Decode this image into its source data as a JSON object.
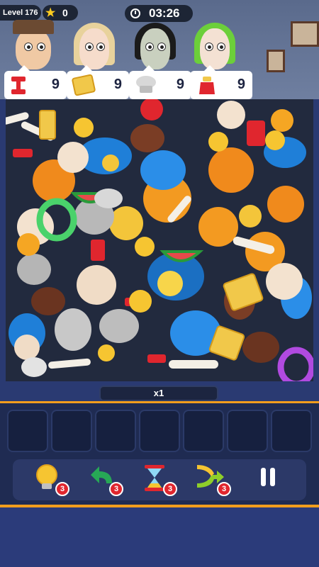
{
  "hud": {
    "level_label": "Level 176",
    "stars": "0",
    "timer": "03:26"
  },
  "orders": [
    {
      "item": "red-dumbbell",
      "count": "9"
    },
    {
      "item": "waffle",
      "count": "9"
    },
    {
      "item": "chef-hat",
      "count": "9"
    },
    {
      "item": "spice-bottle",
      "count": "9"
    }
  ],
  "customers": [
    "bearded-man-with-hat",
    "blonde-woman",
    "pale-curly-haired-man",
    "green-haired-woman"
  ],
  "combo": "x1",
  "tray_slots": 7,
  "boosters": [
    {
      "name": "lightbulb-hint",
      "count": "3"
    },
    {
      "name": "undo-arrow",
      "count": "3"
    },
    {
      "name": "hourglass-freeze",
      "count": "3"
    },
    {
      "name": "shuffle",
      "count": "3"
    }
  ],
  "colors": {
    "accent": "#f29d1d",
    "board": "#222a3e",
    "tray": "#1f2b52",
    "badge": "#e0262e"
  }
}
